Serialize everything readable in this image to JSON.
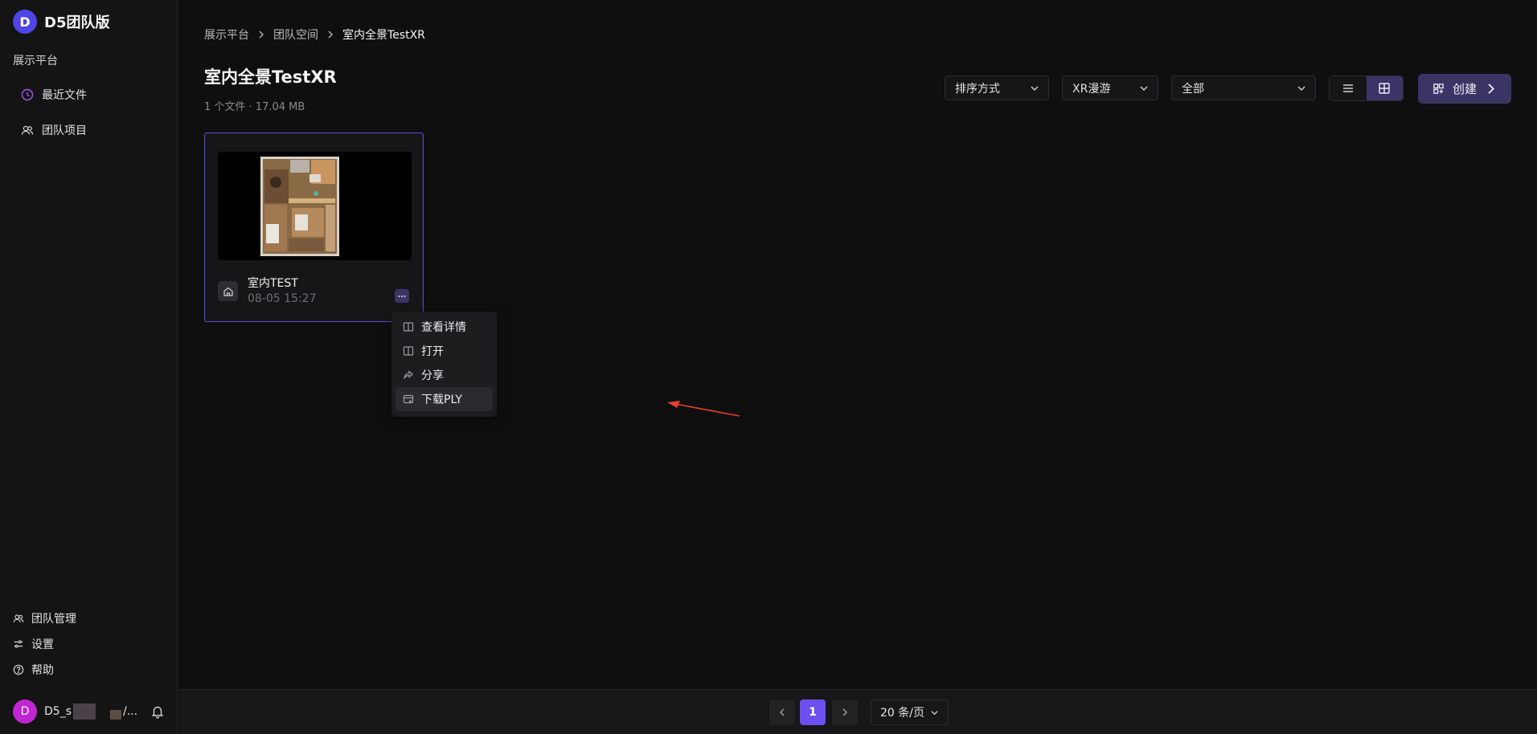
{
  "brand": {
    "logo_letter": "D",
    "name": "D5团队版"
  },
  "sidebar": {
    "section_label": "展示平台",
    "items": [
      {
        "label": "最近文件",
        "icon": "clock-icon"
      },
      {
        "label": "团队项目",
        "icon": "users-icon"
      }
    ],
    "bottom_items": [
      {
        "label": "团队管理",
        "icon": "users-icon"
      },
      {
        "label": "设置",
        "icon": "sliders-icon"
      },
      {
        "label": "帮助",
        "icon": "help-circle-icon"
      }
    ],
    "user": {
      "avatar_letter": "D",
      "name_prefix": "D5_s",
      "name_suffix": "/..."
    }
  },
  "breadcrumb": [
    "展示平台",
    "团队空间",
    "室内全景TestXR"
  ],
  "page": {
    "title": "室内全景TestXR",
    "meta": "1 个文件 · 17.04 MB"
  },
  "toolbar": {
    "sort_label": "排序方式",
    "type_filter": "XR漫游",
    "scope_filter": "全部",
    "create_label": "创建"
  },
  "card": {
    "name": "室内TEST",
    "date": "08-05 15:27"
  },
  "context_menu": [
    {
      "label": "查看详情",
      "icon": "panel-icon"
    },
    {
      "label": "打开",
      "icon": "panel-icon"
    },
    {
      "label": "分享",
      "icon": "share-icon"
    },
    {
      "label": "下载PLY",
      "icon": "download-box-icon"
    }
  ],
  "pagination": {
    "current": "1",
    "page_size": "20 条/页"
  },
  "colors": {
    "accent": "#6d4ff0",
    "accent_dark": "#3b3566",
    "annotation": "#e5402f"
  }
}
